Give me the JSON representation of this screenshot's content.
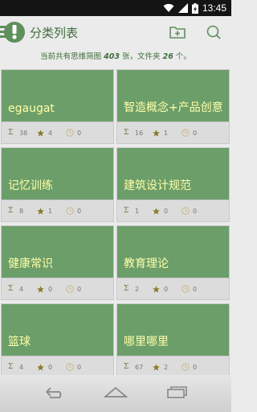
{
  "status_bar": {
    "time": "13:45"
  },
  "header": {
    "title": "分类列表"
  },
  "info": {
    "prefix": "当前共有思维简图",
    "mindmap_count": "403",
    "middle": "张，文件夹",
    "folder_count": "26",
    "suffix": "个。"
  },
  "icons": {
    "add_folder": "add-folder-icon",
    "search": "search-icon",
    "count": "sigma-icon",
    "star": "star-icon",
    "clock": "clock-icon"
  },
  "colors": {
    "accent": "#5f8f5c",
    "card": "#6c9e6a",
    "card_text": "#ffffa8",
    "star": "#8a7a2a"
  },
  "categories": [
    {
      "name": "egaugat",
      "count": "38",
      "stars": "4",
      "recent": "0"
    },
    {
      "name": "智造概念+产品创意",
      "count": "16",
      "stars": "1",
      "recent": "0"
    },
    {
      "name": "记忆训练",
      "count": "8",
      "stars": "1",
      "recent": "0"
    },
    {
      "name": "建筑设计规范",
      "count": "1",
      "stars": "0",
      "recent": "0"
    },
    {
      "name": "健康常识",
      "count": "4",
      "stars": "0",
      "recent": "0"
    },
    {
      "name": "教育理论",
      "count": "2",
      "stars": "0",
      "recent": "0"
    },
    {
      "name": "篮球",
      "count": "4",
      "stars": "0",
      "recent": "0"
    },
    {
      "name": "哪里哪里",
      "count": "67",
      "stars": "2",
      "recent": "0"
    }
  ]
}
